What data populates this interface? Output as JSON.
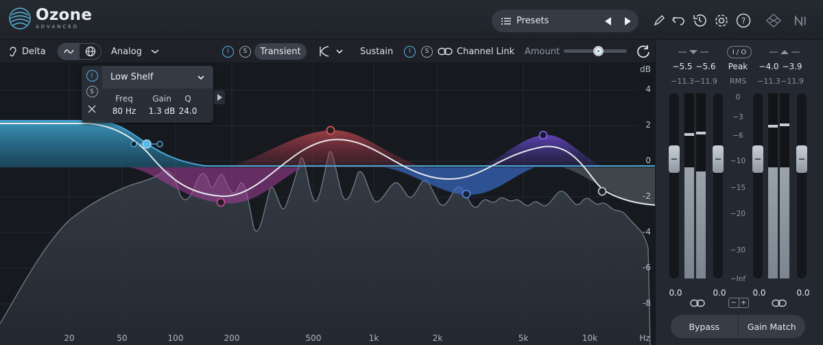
{
  "app": {
    "name": "Ozone",
    "edition": "ADVANCED"
  },
  "header": {
    "presets_label": "Presets",
    "icons": [
      "list-icon",
      "prev-arrow-icon",
      "next-arrow-icon",
      "pencil-icon",
      "undo-icon",
      "history-icon",
      "gear-icon",
      "help-icon",
      "routing-icon",
      "native-instruments-icon"
    ]
  },
  "controls": {
    "delta_label": "Delta",
    "mode_label": "Analog",
    "transient_label": "Transient",
    "sustain_label": "Sustain",
    "channel_link_label": "Channel Link",
    "amount_label": "Amount",
    "amount_value": 0.56,
    "solo_glyph": "S",
    "bypass_glyph": "I"
  },
  "band_panel": {
    "type": "Low Shelf",
    "freq_label": "Freq",
    "freq_value": "80 Hz",
    "gain_label": "Gain",
    "gain_value": "1.3 dB",
    "q_label": "Q",
    "q_value": "24.0"
  },
  "graph": {
    "db_unit": "dB",
    "db_ticks": [
      "4",
      "2",
      "0",
      "-2",
      "-4",
      "-6",
      "-8"
    ],
    "hz_unit": "Hz",
    "hz_ticks": [
      "20",
      "50",
      "100",
      "200",
      "500",
      "1k",
      "2k",
      "5k",
      "10k"
    ]
  },
  "meters": {
    "in_peak": [
      "−5.5",
      "−5.6"
    ],
    "in_rms": [
      "−11.3",
      "−11.9"
    ],
    "out_peak": [
      "−4.0",
      "−3.9"
    ],
    "out_rms": [
      "−11.3",
      "−11.9"
    ],
    "peak_label": "Peak",
    "rms_label": "RMS",
    "io_label": "I / O",
    "scale": [
      "0",
      "−3",
      "−6",
      "−10",
      "−15",
      "−20",
      "−30",
      "−Inf"
    ],
    "fader_values": [
      "0.0",
      "0.0",
      "0.0",
      "0.0"
    ],
    "bypass_label": "Bypass",
    "gain_match_label": "Gain Match",
    "offset_minus": "−",
    "offset_plus": "+"
  },
  "colors": {
    "accent": "#4aa8d8",
    "band_red": "#c94a52",
    "band_violet": "#6a4fc8",
    "band_blue": "#3a6fd0",
    "band_magenta": "#b0409a"
  }
}
